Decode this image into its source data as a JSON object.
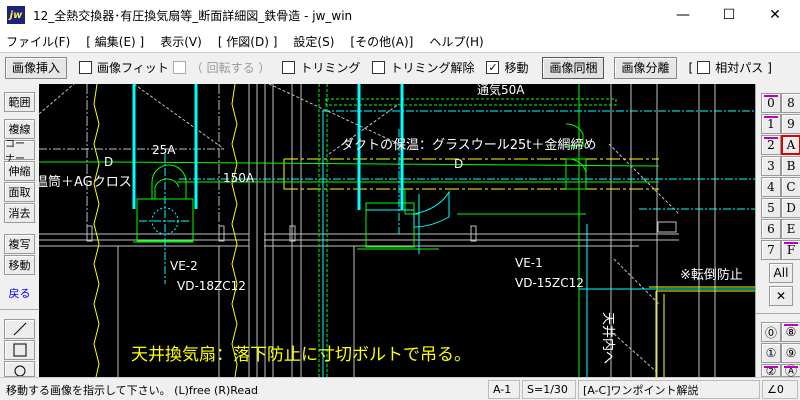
{
  "window": {
    "title": "12_全熱交換器･有圧換気扇等_断面詳細図_鉄骨造 - jw_win",
    "app_icon": "jw",
    "minimize": "—",
    "maximize": "☐",
    "close": "✕"
  },
  "menu": [
    "ファイル(F)",
    "[ 編集(E) ]",
    "表示(V)",
    "[ 作図(D) ]",
    "設定(S)",
    "[その他(A)]",
    "ヘルプ(H)"
  ],
  "toolbar": {
    "insert": "画像挿入",
    "fit": "画像フィット",
    "rotate": "（ 回転する ）",
    "trim": "トリミング",
    "untrim": "トリミング解除",
    "move": "移動",
    "move_checked": true,
    "bundle": "画像同梱",
    "separate": "画像分離",
    "relpath_open": "[",
    "relpath": "相対パス",
    "relpath_close": "]"
  },
  "left_tools": [
    "範囲",
    "複線",
    "コーナー",
    "伸縮",
    "面取",
    "消去",
    "複写",
    "移動",
    "戻る"
  ],
  "left_shapes": [
    "line-icon",
    "rectangle-icon",
    "circle-icon"
  ],
  "layers": {
    "left": [
      "0",
      "1",
      "2",
      "3",
      "4",
      "5",
      "6",
      "7"
    ],
    "right": [
      "8",
      "9",
      "A",
      "B",
      "C",
      "D",
      "E",
      "F"
    ],
    "marked": [
      "0",
      "1",
      "2",
      "F"
    ],
    "selected": "A",
    "all": "All",
    "cross": "✕"
  },
  "groups": {
    "left": [
      "⓪",
      "①",
      "②"
    ],
    "right": [
      "⑧",
      "⑨",
      "Ⓐ"
    ],
    "marked": [
      "2",
      "8",
      "A"
    ]
  },
  "drawing": {
    "labels": {
      "d1": "D",
      "d2": "D",
      "insul1": "温筒＋AGクロス",
      "a25": "25A",
      "a150": "150A",
      "vent": "通気50A",
      "duct": "ダクトの保温：グラスウール25t＋金網締め",
      "ve2": "VE-2",
      "vd2": "VD-18ZC12",
      "ve1": "VE-1",
      "vd1": "VD-15ZC12",
      "tip": "※転倒防止",
      "ceiling": "天井内へ",
      "note": "天井換気扇：落下防止に寸切ボルトで吊る。"
    },
    "colors": {
      "bg": "#000000",
      "green": "#00ff00",
      "cyan": "#00ffff",
      "yellow": "#ffff00",
      "white": "#ffffff",
      "gray": "#c0c0c0"
    }
  },
  "status": {
    "message": "移動する画像を指示して下さい。 (L)free (R)Read",
    "layer": "A-1",
    "scale": "S=1/30",
    "hint": "[A-C]ワンポイント解説",
    "angle": "∠0"
  }
}
